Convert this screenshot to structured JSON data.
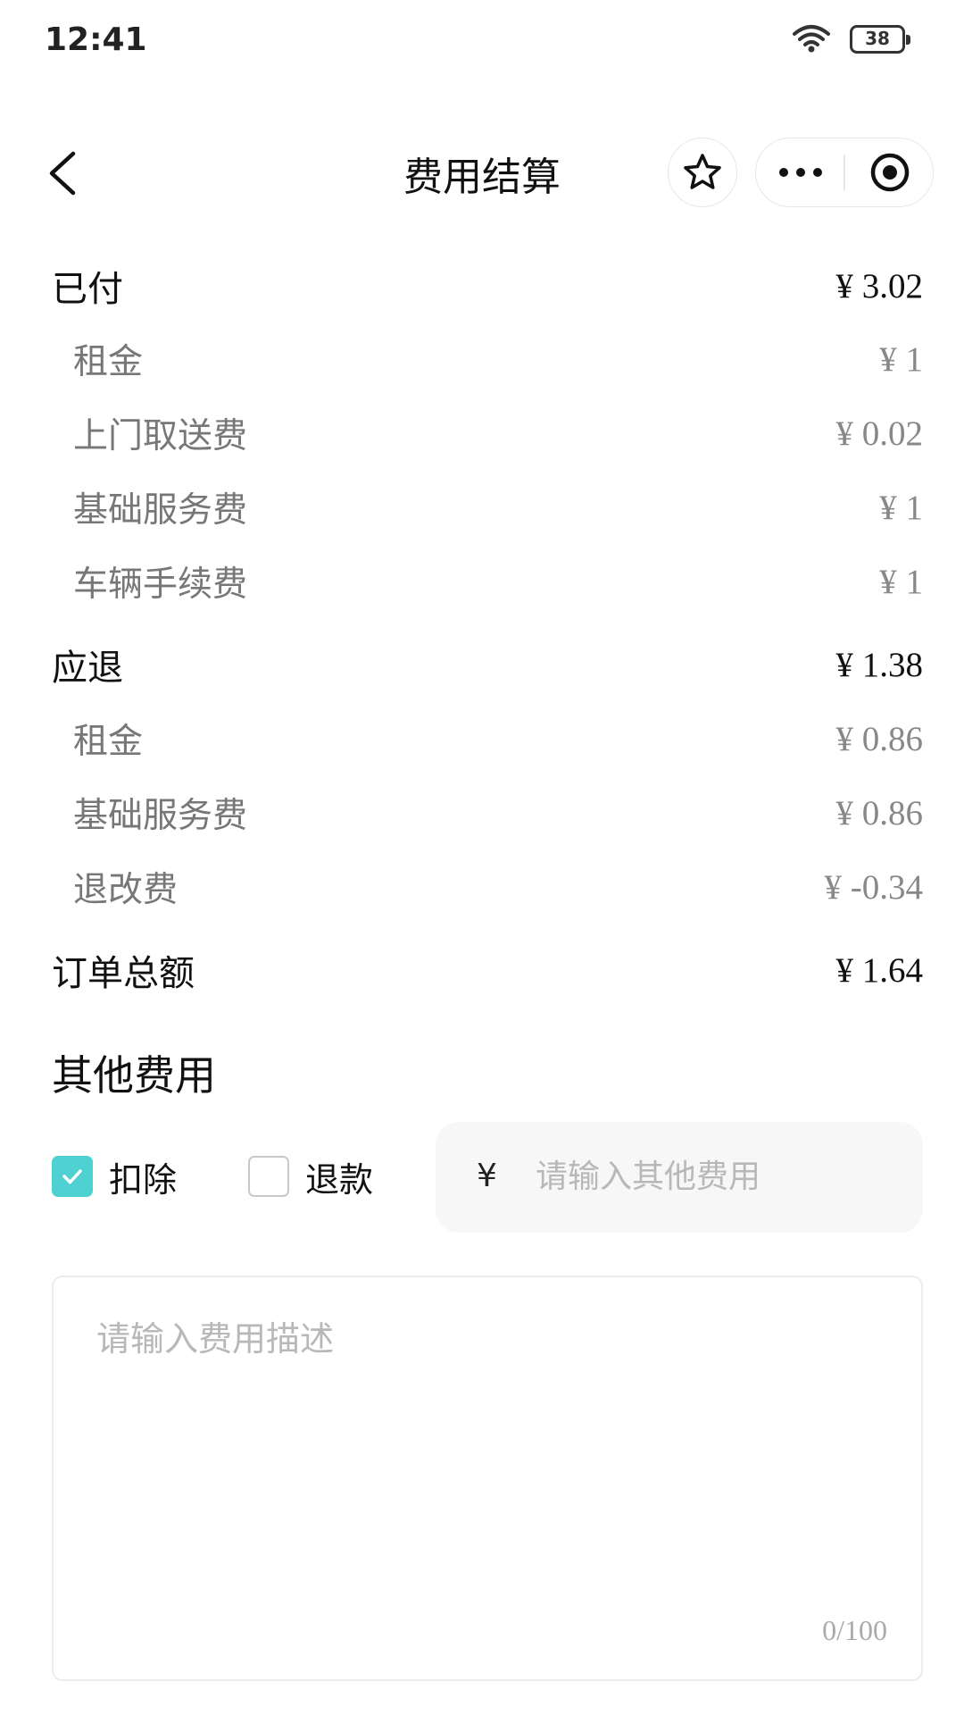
{
  "status_bar": {
    "time": "12:41",
    "battery": "38"
  },
  "nav": {
    "title": "费用结算"
  },
  "paid": {
    "label": "已付",
    "amount": "¥ 3.02",
    "items": [
      {
        "label": "租金",
        "amount": "¥ 1"
      },
      {
        "label": "上门取送费",
        "amount": "¥ 0.02"
      },
      {
        "label": "基础服务费",
        "amount": "¥ 1"
      },
      {
        "label": "车辆手续费",
        "amount": "¥ 1"
      }
    ]
  },
  "refund": {
    "label": "应退",
    "amount": "¥ 1.38",
    "items": [
      {
        "label": "租金",
        "amount": "¥ 0.86"
      },
      {
        "label": "基础服务费",
        "amount": "¥ 0.86"
      },
      {
        "label": "退改费",
        "amount": "¥ -0.34"
      }
    ]
  },
  "order_total": {
    "label": "订单总额",
    "amount": "¥ 1.64"
  },
  "other_fees": {
    "title": "其他费用",
    "deduct_label": "扣除",
    "deduct_checked": true,
    "refund_label": "退款",
    "refund_checked": false,
    "currency_symbol": "¥",
    "amount_placeholder": "请输入其他费用",
    "desc_placeholder": "请输入费用描述",
    "desc_counter": "0/100"
  },
  "colors": {
    "accent": "#4fd1d2",
    "muted_text": "#777777",
    "input_bg": "#f7f7f7"
  }
}
